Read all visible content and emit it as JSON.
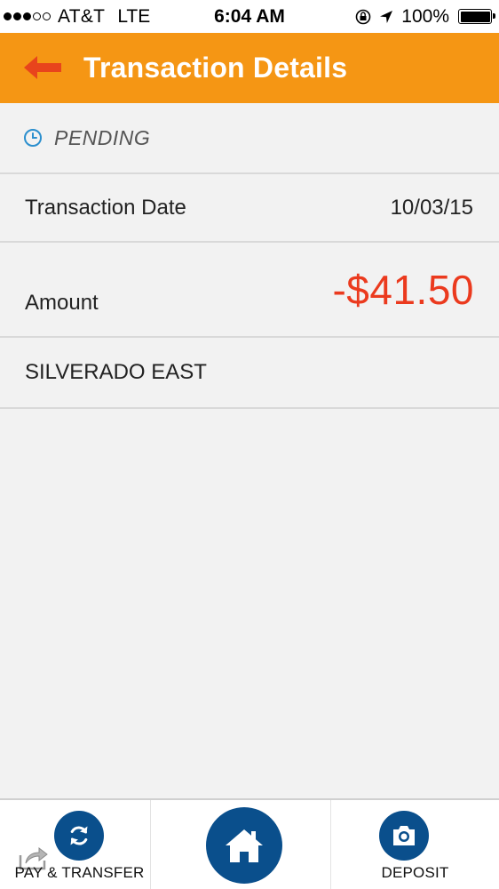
{
  "status_bar": {
    "carrier": "AT&T",
    "network": "LTE",
    "time": "6:04 AM",
    "battery": "100%",
    "battery_level": 1.0,
    "signal_strength": 3,
    "signal_max": 5
  },
  "header": {
    "title": "Transaction Details",
    "background": "#f59614",
    "back_icon": "back-arrow-icon"
  },
  "transaction": {
    "status": "PENDING",
    "status_icon": "clock-icon",
    "date_label": "Transaction Date",
    "date_value": "10/03/15",
    "amount_label": "Amount",
    "amount_value": "-$41.50",
    "amount_color": "#eb3a1e",
    "merchant": "SILVERADO EAST"
  },
  "tabbar": {
    "pay_transfer_label": "PAY & TRANSFER",
    "pay_transfer_icon": "refresh-icon",
    "home_icon": "home-icon",
    "deposit_label": "DEPOSIT",
    "deposit_icon": "camera-icon",
    "accent": "#0a4f8c"
  }
}
